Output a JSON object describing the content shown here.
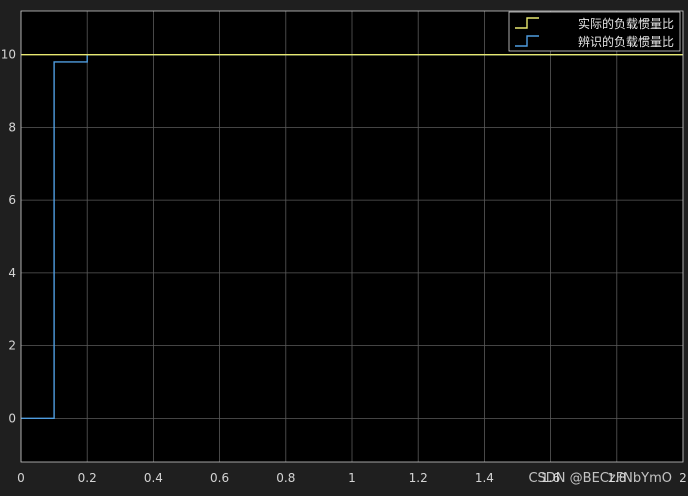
{
  "chart_data": {
    "type": "line",
    "title": "",
    "xlabel": "",
    "ylabel": "",
    "xlim": [
      0,
      2
    ],
    "ylim": [
      -1.2,
      11.2
    ],
    "xticks": [
      0,
      0.2,
      0.4,
      0.6,
      0.8,
      1,
      1.2,
      1.4,
      1.6,
      1.8,
      2
    ],
    "xtick_labels": [
      "0",
      "0.2",
      "0.4",
      "0.6",
      "0.8",
      "1",
      "1.2",
      "1.4",
      "1.6",
      "1.8",
      "2"
    ],
    "yticks": [
      0,
      2,
      4,
      6,
      8,
      10
    ],
    "ytick_labels": [
      "0",
      "2",
      "4",
      "6",
      "8",
      "10"
    ],
    "grid": true,
    "legend_position": "top-right",
    "series": [
      {
        "name": "实际的负载惯量比",
        "color": "#e8e870",
        "step": true,
        "x": [
          0,
          2
        ],
        "y": [
          10,
          10
        ]
      },
      {
        "name": "辨识的负载惯量比",
        "color": "#4f9de0",
        "step": true,
        "x": [
          0,
          0.1,
          0.1,
          0.2,
          0.2,
          2
        ],
        "y": [
          0,
          0,
          9.8,
          9.8,
          10,
          10
        ]
      }
    ]
  },
  "colors": {
    "background": "#1f1f1f",
    "plot_area": "#000000",
    "grid": "#5a5a5a",
    "axis": "#c8c8c8",
    "tick_text": "#d4d4d4"
  },
  "watermark": "CSDN @BECzFNbYmO"
}
